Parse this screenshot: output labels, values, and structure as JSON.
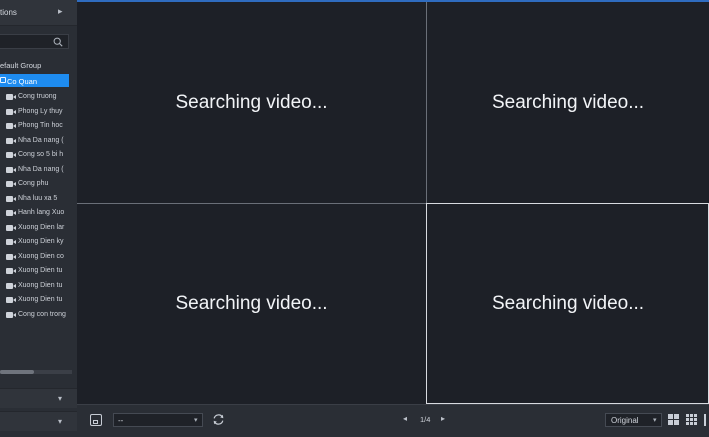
{
  "sidebar": {
    "header_label": "tions",
    "search": {
      "placeholder": "",
      "value": ""
    },
    "tree_root": "efault Group",
    "group": "Co Quan",
    "cameras": [
      "Cong truong",
      "Phong Ly thuy",
      "Phong Tin hoc",
      "Nha Da nang (",
      "Cong so 5 bi h",
      "Nha Da nang (",
      "Cong phu",
      "Nha luu xa 5",
      "Hanh lang Xuo",
      "Xuong Dien lar",
      "Xuong Dien ky",
      "Xuong Dien co",
      "Xuong Dien tu",
      "Xuong Dien tu",
      "Xuong Dien tu",
      "Cong con trong"
    ]
  },
  "grid": {
    "tiles": [
      {
        "message": "Searching video..."
      },
      {
        "message": "Searching video..."
      },
      {
        "message": "Searching video..."
      },
      {
        "message": "Searching video..."
      }
    ],
    "selected_tile": 4
  },
  "toolbar": {
    "preset_value": "--",
    "page_indicator": "1/4",
    "ratio_value": "Original"
  },
  "colors": {
    "accent": "#1e8cf0",
    "background": "#1d2027",
    "sidebar": "#2a2e35",
    "text": "#f2f4f7"
  },
  "icons": {
    "sidebar_header": "chevron-right-icon",
    "search": "search-icon",
    "group": "folder-icon",
    "camera": "camera-icon",
    "save": "save-icon",
    "refresh": "refresh-icon",
    "prev": "chevron-left-icon",
    "next": "chevron-right-icon",
    "layout_4": "grid-2x2-icon",
    "layout_9": "grid-3x3-icon"
  }
}
